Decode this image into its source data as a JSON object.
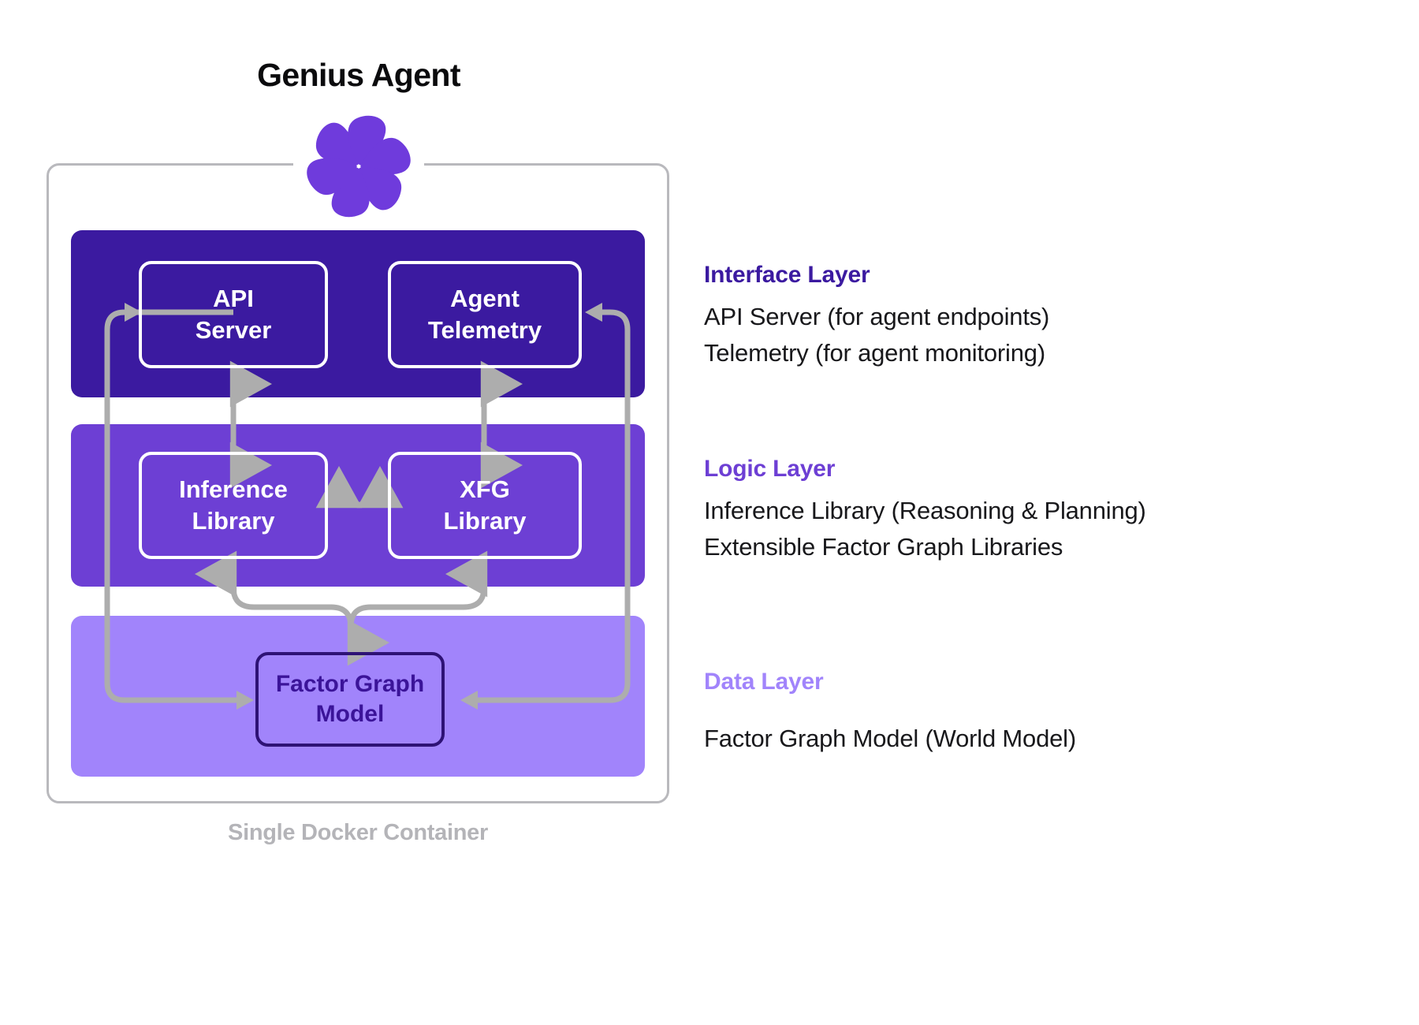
{
  "diagram": {
    "title": "Genius Agent",
    "logo_icon": "genius-flower-logo-icon",
    "container_caption": "Single Docker Container",
    "colors": {
      "interface_band": "#3B1AA0",
      "logic_band": "#6D3FD4",
      "data_band": "#A184FB",
      "interface_title": "#3B1AA0",
      "logic_title": "#6D3FD4",
      "data_title": "#A184FB",
      "connector": "#ADADAD",
      "container_outline": "#B9B9BD",
      "caption": "#B4B4B8",
      "factor_graph_border": "#2E1275",
      "factor_graph_text": "#3B1499",
      "logo": "#6F3BDC"
    },
    "bands": [
      {
        "id": "interface",
        "nodes": [
          "API Server",
          "Agent Telemetry"
        ]
      },
      {
        "id": "logic",
        "nodes": [
          "Inference Library",
          "XFG Library"
        ]
      },
      {
        "id": "data",
        "nodes": [
          "Factor Graph Model"
        ]
      }
    ],
    "nodes": {
      "api_server": {
        "line1": "API",
        "line2": "Server"
      },
      "agent_telemetry": {
        "line1": "Agent",
        "line2": "Telemetry"
      },
      "inference_library": {
        "line1": "Inference",
        "line2": "Library"
      },
      "xfg_library": {
        "line1": "XFG",
        "line2": "Library"
      },
      "factor_graph_model": {
        "line1": "Factor Graph",
        "line2": "Model"
      }
    }
  },
  "legend": {
    "interface": {
      "title": "Interface Layer",
      "line1": "API Server (for agent endpoints)",
      "line2": "Telemetry (for agent monitoring)"
    },
    "logic": {
      "title": "Logic Layer",
      "line1": "Inference Library (Reasoning & Planning)",
      "line2": "Extensible Factor Graph Libraries"
    },
    "data": {
      "title": "Data Layer",
      "line1": "Factor Graph Model (World Model)",
      "line2": ""
    }
  }
}
